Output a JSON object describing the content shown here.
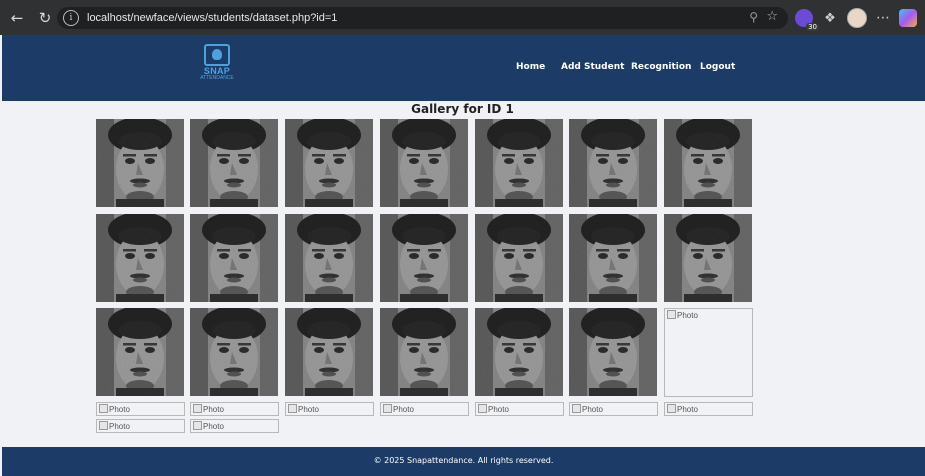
{
  "browser": {
    "url": "localhost/newface/views/students/dataset.php?id=1",
    "extension_badge_count": "30",
    "back_icon": "arrow-left-icon",
    "refresh_icon": "refresh-icon"
  },
  "site": {
    "brand": "SNAP",
    "brand_sub": "ATTENDANCE",
    "nav": [
      "Home",
      "Add Student",
      "Recognition",
      "Logout"
    ]
  },
  "gallery": {
    "title": "Gallery for ID 1",
    "broken_alt": "Photo",
    "loaded_photos": 20,
    "broken_photos": 10
  },
  "footer": {
    "text": "© 2025 Snapattendance. All rights reserved."
  },
  "colors": {
    "header": "#1c3c67",
    "background": "#f1f2f6",
    "accent": "#4aa3df"
  }
}
